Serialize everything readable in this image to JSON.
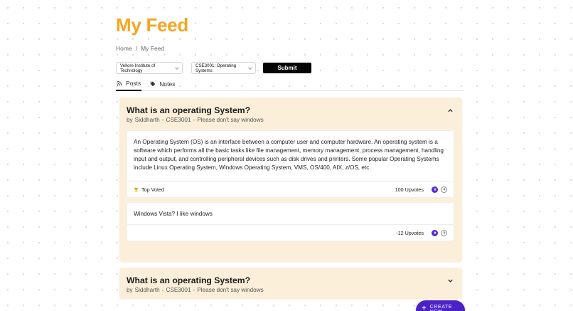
{
  "header": {
    "title": "My Feed"
  },
  "breadcrumb": {
    "home": "Home",
    "separator": "/",
    "current": "My Feed"
  },
  "filters": {
    "institute": {
      "selected": "Vellore Institute of Technology"
    },
    "course": {
      "selected": "CSE3001: Operating Systems"
    },
    "submit_label": "Submit"
  },
  "tabs": [
    {
      "label": "Posts",
      "icon": "rss-icon",
      "active": true
    },
    {
      "label": "Notes",
      "icon": "tag-icon",
      "active": false
    }
  ],
  "posts": [
    {
      "title": "What is an operating System?",
      "meta": {
        "by": "by",
        "author": "Siddharth",
        "sep1": "-",
        "course": "CSE3001",
        "sep2": "-",
        "note": "Please don't say windows"
      },
      "expanded": true,
      "answers": [
        {
          "body": "An Operating System (OS) is an interface between a computer user and computer hardware. An operating system is a software which performs all the basic tasks like file management, memory management, process management, handling input and output, and controlling peripheral devices such as disk drives and printers. Some popular Operating Systems include Linux Operating System, Windows Operating System, VMS, OS/400, AIX, z/OS, etc.",
          "badge": "Top Voted",
          "upvotes_text": "100 Upvotes"
        },
        {
          "body": "Windows Vista? I like windows",
          "badge": "",
          "upvotes_text": "-12 Upvotes"
        }
      ]
    },
    {
      "title": "What is an operating System?",
      "meta": {
        "by": "by",
        "author": "Siddharth",
        "sep1": "-",
        "course": "CSE3001",
        "sep2": "-",
        "note": "Please don't say windows"
      },
      "expanded": false
    }
  ],
  "fab": {
    "label": "CREATE NEW",
    "icon": "plus-icon"
  },
  "colors": {
    "title": "#f5a623",
    "card": "#fcefd9",
    "accent": "#4b22c8",
    "upvote": "#5a2bd6"
  }
}
